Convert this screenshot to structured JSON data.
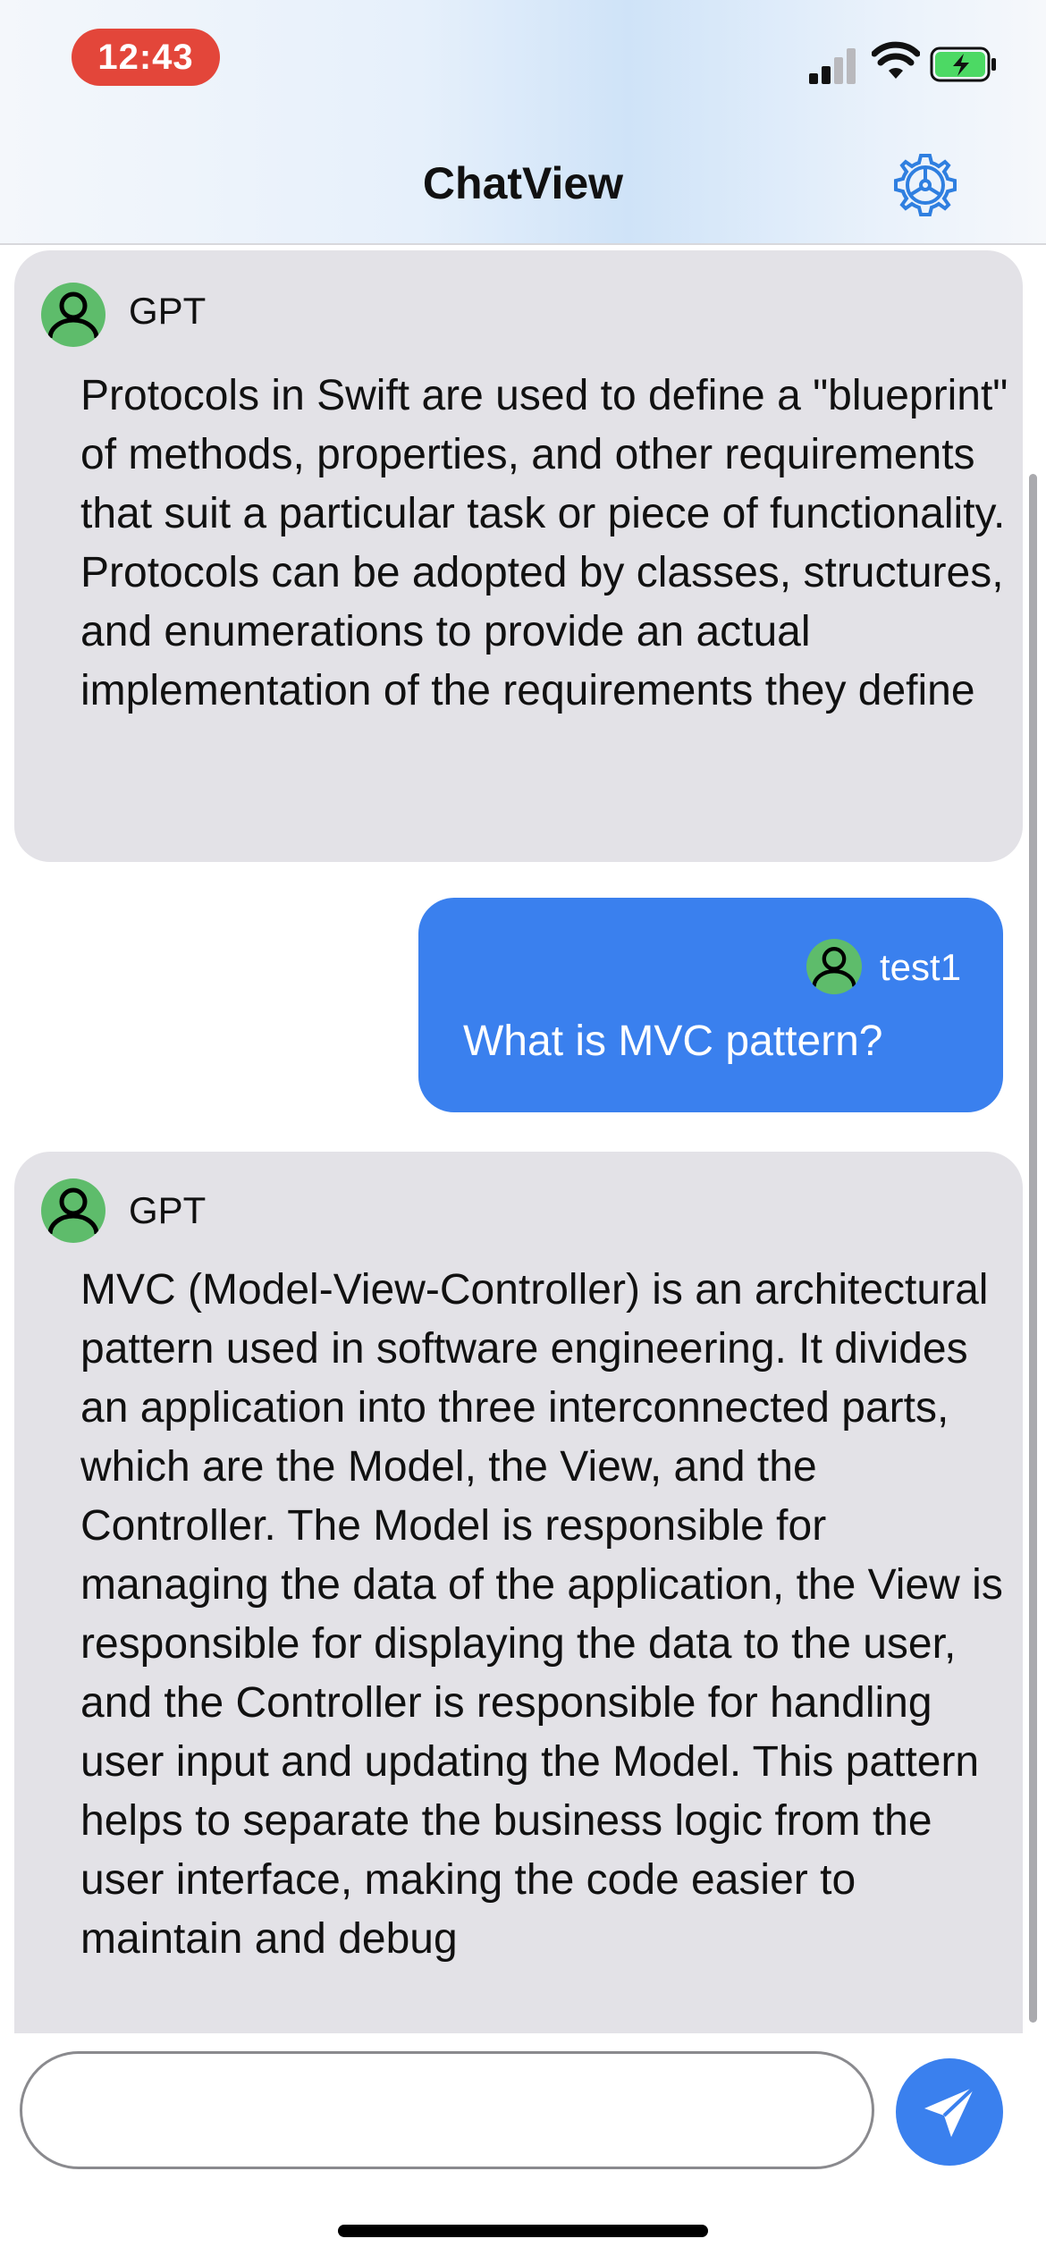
{
  "status_bar": {
    "time": "12:43"
  },
  "nav": {
    "title": "ChatView",
    "settings_icon": "gear-icon"
  },
  "messages": [
    {
      "role": "assistant",
      "sender": "GPT",
      "text": "Protocols in Swift are used to define a \"blueprint\" of methods, properties, and other requirements that suit a particular task or piece of functionality. Protocols can be adopted by classes, structures, and enumerations to provide an actual implementation of the requirements they define"
    },
    {
      "role": "user",
      "sender": "test1",
      "text": "What is MVC pattern?"
    },
    {
      "role": "assistant",
      "sender": "GPT",
      "text": "MVC (Model-View-Controller) is an architectural pattern used in software engineering. It divides an application into three interconnected parts, which are the Model, the View, and the Controller. The Model is responsible for managing the data of the application, the View is responsible for displaying the data to the user, and the Controller is responsible for handling user input and updating the Model. This pattern helps to separate the business logic from the user interface, making the code easier to maintain and debug"
    }
  ],
  "composer": {
    "value": "",
    "placeholder": "",
    "send_icon": "paper-plane-icon"
  },
  "colors": {
    "user_bubble": "#3a80ee",
    "assistant_bubble": "#e3e2e7",
    "avatar": "#5ebc6b",
    "time_pill": "#e3463a"
  }
}
